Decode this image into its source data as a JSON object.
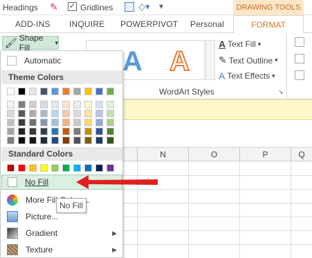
{
  "topbar": {
    "headings": "Headings",
    "gridlines": "Gridlines",
    "drawing_tools": "DRAWING TOOLS"
  },
  "tabs": {
    "add_ins": "ADD-INS",
    "inquire": "INQUIRE",
    "powerpivot": "POWERPIVOT",
    "personal": "Personal",
    "format": "FORMAT"
  },
  "ribbon": {
    "shape_fill": "Shape Fill",
    "text_fill": "Text Fill",
    "text_outline": "Text Outline",
    "text_effects": "Text Effects",
    "wordart_styles": "WordArt Styles",
    "wordart_glyph": "A"
  },
  "menu": {
    "automatic": "Automatic",
    "theme_colors": "Theme Colors",
    "standard_colors": "Standard Colors",
    "no_fill": "No Fill",
    "more_fill": "More Fill Colors...",
    "picture": "Picture...",
    "gradient": "Gradient",
    "texture": "Texture"
  },
  "tooltip": "No Fill",
  "columns": [
    "N",
    "O",
    "P",
    "Q"
  ],
  "colors": {
    "accent_format": "#d47a22",
    "ribbon_green": "#cfe8d8",
    "red_arrow": "#e0201f",
    "highlight": "#d9efe0"
  },
  "theme_top": [
    "#ffffff",
    "#000000",
    "#e7e6e6",
    "#44546a",
    "#5b9bd5",
    "#ed7d31",
    "#a5a5a5",
    "#ffc000",
    "#4472c4",
    "#70ad47"
  ],
  "theme_shades": [
    [
      "#f2f2f2",
      "#7f7f7f",
      "#d0cece",
      "#d6dce4",
      "#deebf6",
      "#fbe5d5",
      "#ededed",
      "#fff2cc",
      "#d9e2f3",
      "#e2efd9"
    ],
    [
      "#d8d8d8",
      "#595959",
      "#aeaaaa",
      "#adb9ca",
      "#bdd7ee",
      "#f7cbac",
      "#dbdbdb",
      "#fee599",
      "#b4c6e7",
      "#c5e0b3"
    ],
    [
      "#bfbfbf",
      "#3f3f3f",
      "#757070",
      "#8496b0",
      "#9cc3e5",
      "#f4b183",
      "#c9c9c9",
      "#ffd966",
      "#8eaadb",
      "#a8d08d"
    ],
    [
      "#a5a5a5",
      "#262626",
      "#3a3838",
      "#323f4f",
      "#2e75b5",
      "#c45911",
      "#7b7b7b",
      "#bf9000",
      "#2f5496",
      "#538135"
    ],
    [
      "#7f7f7f",
      "#0c0c0c",
      "#171616",
      "#222a35",
      "#1e4e79",
      "#833c0b",
      "#525252",
      "#7f6000",
      "#1f3864",
      "#375623"
    ]
  ],
  "standard": [
    "#c00000",
    "#ff0000",
    "#ffc000",
    "#ffff00",
    "#92d050",
    "#00b050",
    "#00b0f0",
    "#0070c0",
    "#002060",
    "#7030a0"
  ]
}
